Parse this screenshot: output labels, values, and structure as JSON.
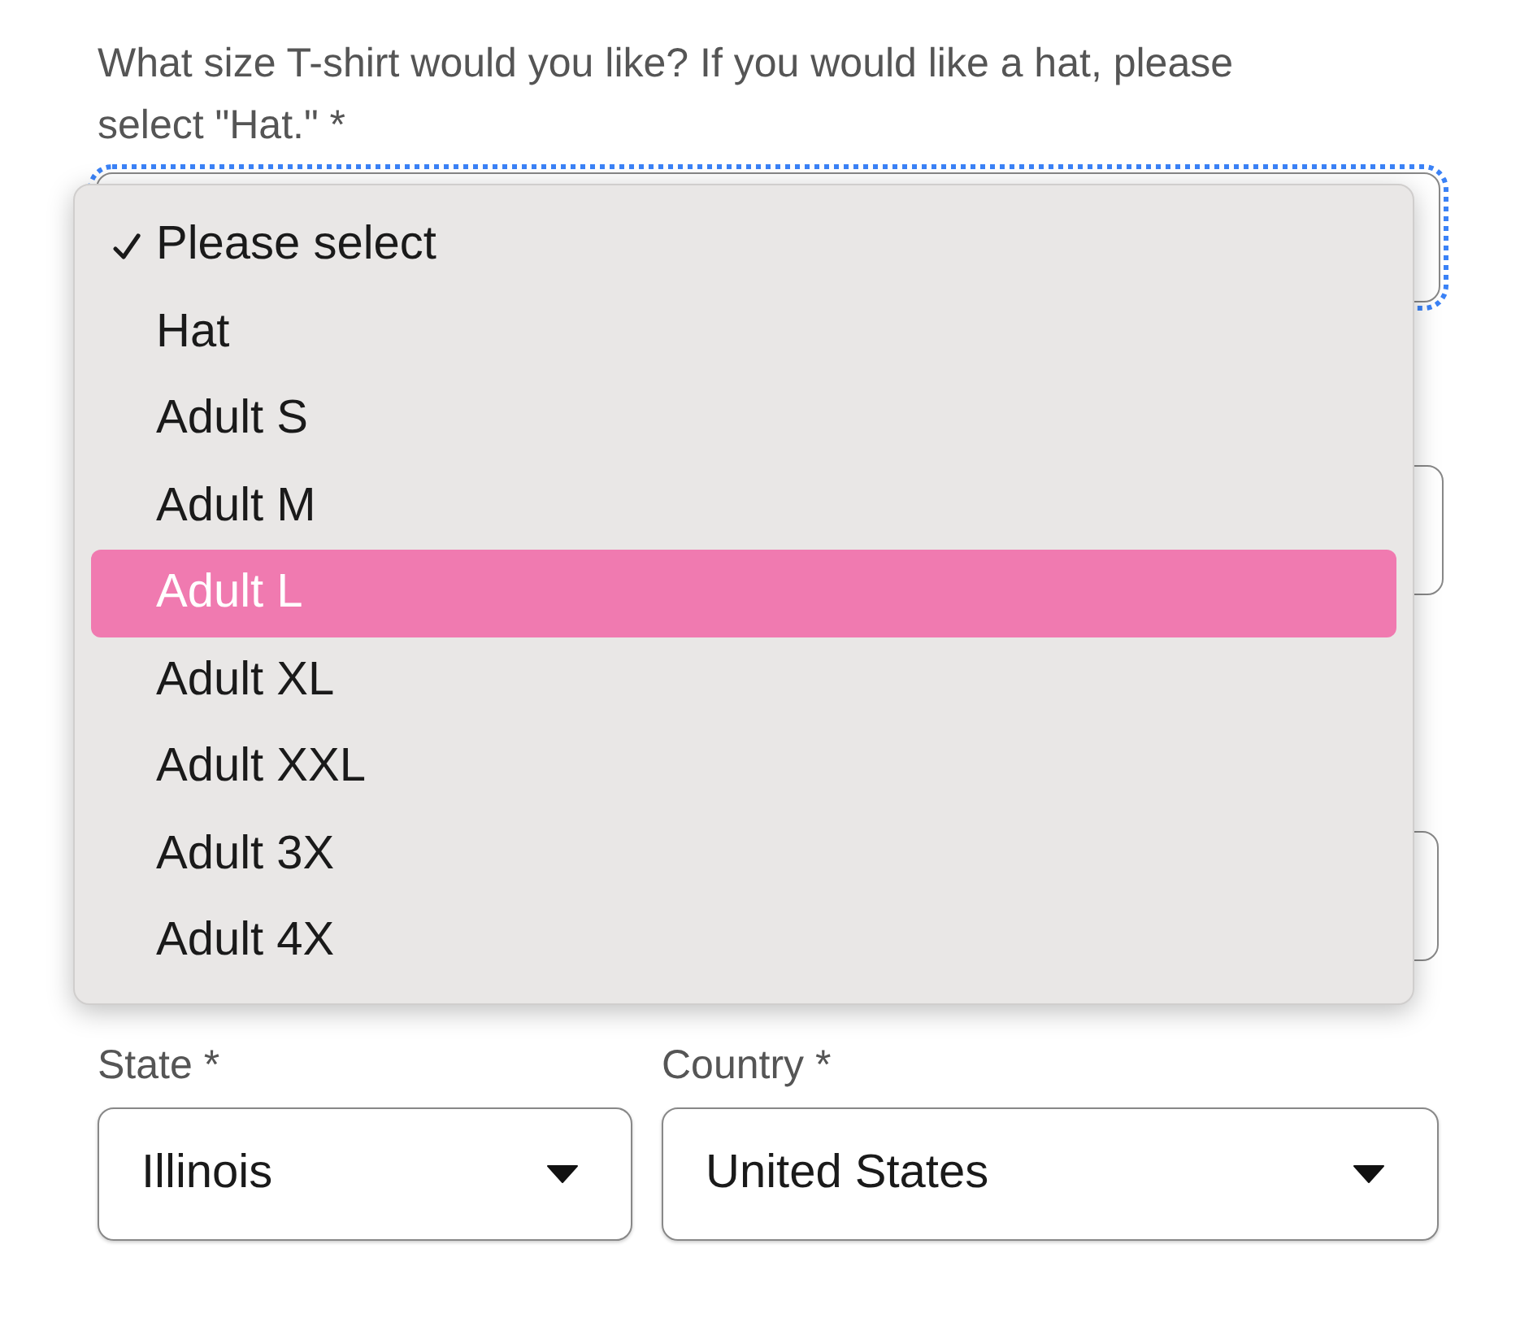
{
  "question": {
    "label": "What size T-shirt would you like? If you would like a hat, please select \"Hat.\" *",
    "focused": true
  },
  "size_menu": {
    "options": [
      {
        "label": "Please select",
        "checked": true,
        "selected": false
      },
      {
        "label": "Hat",
        "checked": false,
        "selected": false
      },
      {
        "label": "Adult S",
        "checked": false,
        "selected": false
      },
      {
        "label": "Adult M",
        "checked": false,
        "selected": false
      },
      {
        "label": "Adult L",
        "checked": false,
        "selected": true
      },
      {
        "label": "Adult XL",
        "checked": false,
        "selected": false
      },
      {
        "label": "Adult XXL",
        "checked": false,
        "selected": false
      },
      {
        "label": "Adult 3X",
        "checked": false,
        "selected": false
      },
      {
        "label": "Adult 4X",
        "checked": false,
        "selected": false
      }
    ]
  },
  "fields": [
    {
      "label": "State *",
      "value": "Illinois"
    },
    {
      "label": "Country *",
      "value": "United States"
    }
  ]
}
